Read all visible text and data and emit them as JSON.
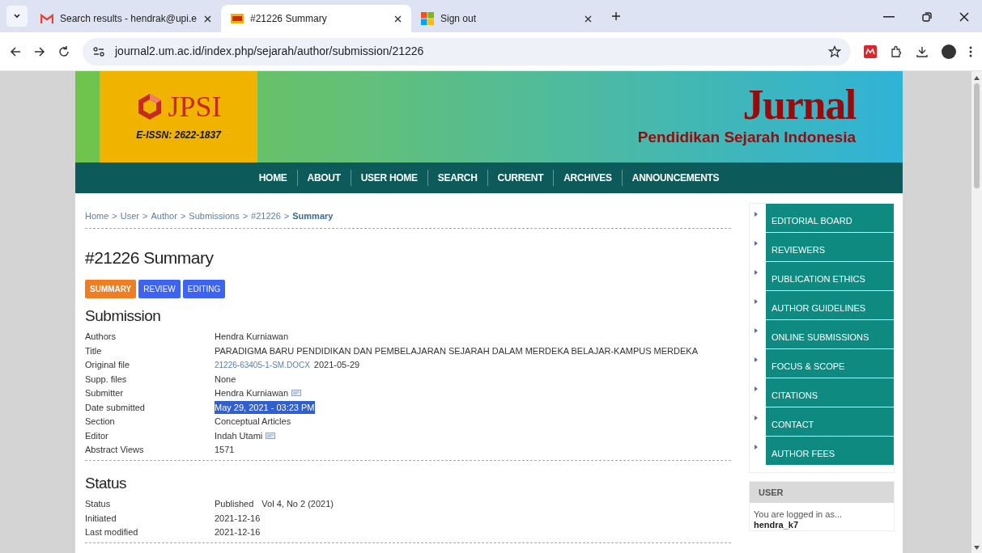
{
  "browser": {
    "tabs": [
      {
        "title": "Search results - hendrak@upi.e",
        "kind": "mail",
        "selected": false
      },
      {
        "title": "#21226 Summary",
        "kind": "site",
        "selected": true
      },
      {
        "title": "Sign out",
        "kind": "squares",
        "selected": false
      }
    ],
    "url": "journal2.um.ac.id/index.php/sejarah/author/submission/21226"
  },
  "banner": {
    "logo": "JPSI",
    "issn": "E-ISSN: 2622-1837",
    "journal": "Jurnal",
    "subtitle": "Pendidikan Sejarah Indonesia"
  },
  "nav": [
    "HOME",
    "ABOUT",
    "USER HOME",
    "SEARCH",
    "CURRENT",
    "ARCHIVES",
    "ANNOUNCEMENTS"
  ],
  "breadcrumb": [
    {
      "label": "Home",
      "kind": "link"
    },
    {
      "label": ">",
      "kind": "separator"
    },
    {
      "label": "User",
      "kind": "link"
    },
    {
      "label": ">",
      "kind": "separator"
    },
    {
      "label": "Author",
      "kind": "link"
    },
    {
      "label": ">",
      "kind": "separator"
    },
    {
      "label": "Submissions",
      "kind": "link"
    },
    {
      "label": ">",
      "kind": "separator"
    },
    {
      "label": "#21226",
      "kind": "link"
    },
    {
      "label": ">",
      "kind": "separator"
    },
    {
      "label": "Summary",
      "kind": "current"
    }
  ],
  "page_title": "#21226 Summary",
  "tabs": [
    {
      "label": "SUMMARY",
      "selected": true
    },
    {
      "label": "REVIEW",
      "selected": false
    },
    {
      "label": "EDITING",
      "selected": false
    }
  ],
  "sections": [
    {
      "heading": "Submission",
      "rows": [
        {
          "label": "Authors",
          "value": "Hendra Kurniawan",
          "kind": "plain"
        },
        {
          "label": "Title",
          "value": "PARADIGMA BARU PENDIDIKAN DAN PEMBELAJARAN SEJARAH DALAM MERDEKA BELAJAR-KAMPUS MERDEKA",
          "kind": "plain"
        },
        {
          "label": "Original file",
          "value": "21226-63405-1-SM.DOCX",
          "extra": "2021-05-29",
          "kind": "file"
        },
        {
          "label": "Supp. files",
          "value": "None",
          "kind": "plain"
        },
        {
          "label": "Submitter",
          "value": "Hendra Kurniawan",
          "kind": "contact"
        },
        {
          "label": "Date submitted",
          "value": "May 29, 2021 - 03:23 PM",
          "kind": "plain",
          "highlighted": true
        },
        {
          "label": "Section",
          "value": "Conceptual Articles",
          "kind": "plain"
        },
        {
          "label": "Editor",
          "value": "Indah Utami",
          "kind": "contact"
        },
        {
          "label": "Abstract Views",
          "value": "1571",
          "kind": "plain"
        }
      ]
    },
    {
      "heading": "Status",
      "rows": [
        {
          "label": "Status",
          "value": "Published",
          "extra": "Vol 4, No 2 (2021)",
          "kind": "pair"
        },
        {
          "label": "Initiated",
          "value": "2021-12-16",
          "kind": "plain"
        },
        {
          "label": "Last modified",
          "value": "2021-12-16",
          "kind": "plain"
        }
      ]
    }
  ],
  "sidebar": {
    "menu": [
      "EDITORIAL BOARD",
      "REVIEWERS",
      "PUBLICATION ETHICS",
      "AUTHOR GUIDELINES",
      "ONLINE SUBMISSIONS",
      "FOCUS & SCOPE",
      "CITATIONS",
      "CONTACT",
      "AUTHOR FEES"
    ],
    "user": {
      "heading": "USER",
      "text": "You are logged in as...",
      "username": "hendra_k7"
    }
  }
}
